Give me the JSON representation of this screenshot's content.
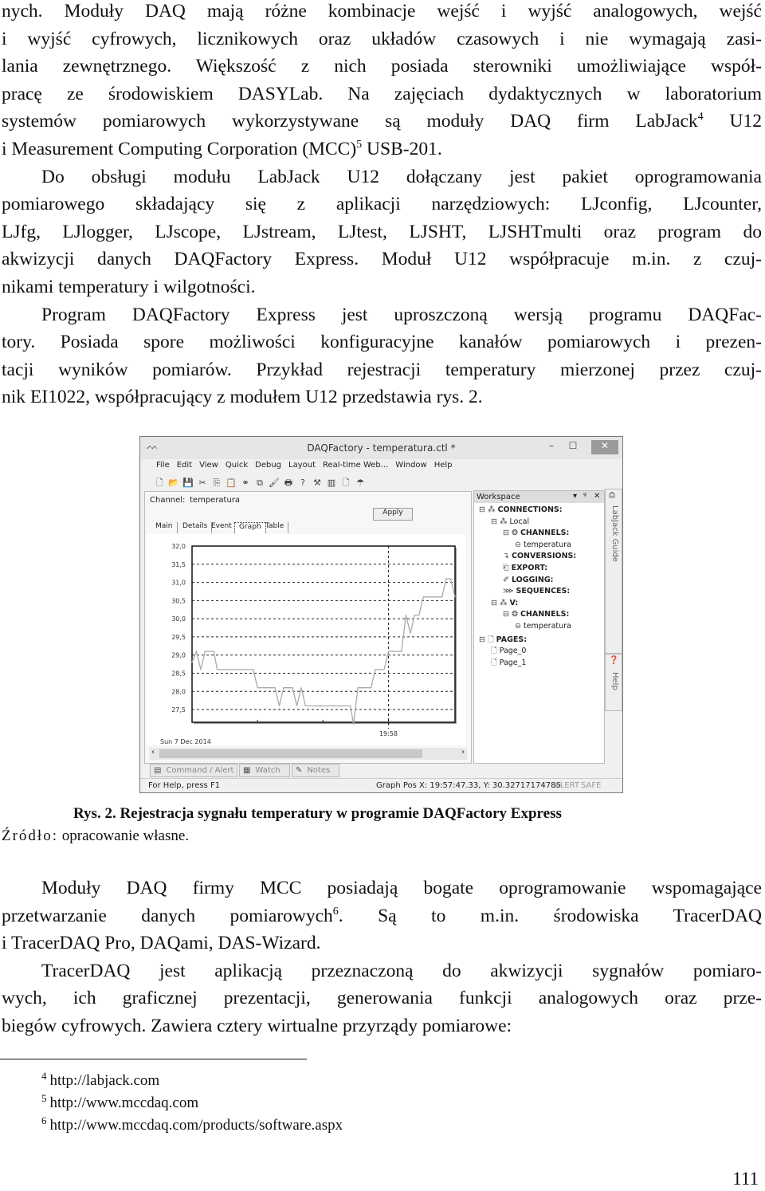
{
  "paragraphs_top": [
    {
      "indent": false,
      "lines": [
        {
          "t": "nych. Moduły DAQ mają różne kombinacje wejść i wyjść analogowych, wejść"
        },
        {
          "t": "i wyjść cyfrowych, licznikowych oraz układów czasowych i nie wymagają zasi-"
        },
        {
          "t": "lania zewnętrznego. Większość z nich posiada sterowniki umożliwiające współ-"
        },
        {
          "t": "pracę ze środowiskiem DASYLab. Na zajęciach dydaktycznych w laboratorium"
        },
        {
          "t": "systemów pomiarowych wykorzystywane są moduły DAQ firm LabJack",
          "sup": "4",
          "t2": " U12"
        },
        {
          "t": "i Measurement Computing Corporation (MCC)",
          "sup": "5",
          "t2": " USB-201."
        }
      ]
    },
    {
      "indent": true,
      "lines": [
        {
          "t": "Do obsługi modułu LabJack U12 dołączany jest pakiet oprogramowania"
        },
        {
          "t": "pomiarowego składający się z aplikacji narzędziowych: LJconfig, LJcounter,"
        },
        {
          "t": "LJfg, LJlogger, LJscope, LJstream, LJtest, LJSHT, LJSHTmulti oraz program do"
        },
        {
          "t": "akwizycji danych DAQFactory Express. Moduł U12 współpracuje m.in. z czuj-"
        },
        {
          "t": "nikami temperatury i wilgotności."
        }
      ]
    },
    {
      "indent": true,
      "lines": [
        {
          "t": "Program DAQFactory Express jest uproszczoną wersją programu DAQFac-"
        },
        {
          "t": "tory. Posiada spore możliwości konfiguracyjne kanałów pomiarowych i prezen-"
        },
        {
          "t": "tacji wyników pomiarów. Przykład rejestracji temperatury mierzonej przez czuj-"
        },
        {
          "t": "nik EI1022, współpracujący z modułem U12 przedstawia rys. 2."
        }
      ]
    }
  ],
  "paragraphs_bottom": [
    {
      "indent": true,
      "lines": [
        {
          "t": "Moduły DAQ firmy MCC posiadają bogate oprogramowanie wspomagające"
        },
        {
          "t": "przetwarzanie danych pomiarowych",
          "sup": "6",
          "t2": ". Są to m.in. środowiska TracerDAQ"
        },
        {
          "t": "i TracerDAQ Pro, DAQami, DAS-Wizard."
        }
      ]
    },
    {
      "indent": true,
      "lines": [
        {
          "t": "TracerDAQ jest aplikacją przeznaczoną do akwizycji sygnałów pomiaro-"
        },
        {
          "t": "wych, ich graficznej prezentacji, generowania funkcji analogowych oraz prze-"
        },
        {
          "t": "biegów cyfrowych. Zawiera cztery wirtualne przyrządy pomiarowe:"
        }
      ]
    }
  ],
  "figure": {
    "caption": "Rys. 2. Rejestracja sygnału temperatury w programie DAQFactory Express",
    "source_label": "Źródło:",
    "source_text": " opracowanie własne."
  },
  "app": {
    "title": "DAQFactory - temperatura.ctl *",
    "window_buttons": {
      "minimize": "–",
      "maximize": "☐",
      "close": "✕"
    },
    "menu": [
      "File",
      "Edit",
      "View",
      "Quick",
      "Debug",
      "Layout",
      "Real-time Web...",
      "Window",
      "Help"
    ],
    "toolbar_icons": [
      "new-icon",
      "open-icon",
      "save-icon",
      "cut-icon",
      "copy-icon",
      "paste-icon",
      "link-icon",
      "duplicate-icon",
      "brush-icon",
      "print-icon",
      "help-icon",
      "tools-icon",
      "chart-icon",
      "page-icon",
      "daq-icon"
    ],
    "toolbar_glyphs": [
      "🗋",
      "📂",
      "💾",
      "✂",
      "⎘",
      "📋",
      "⚭",
      "⧉",
      "🖌",
      "🖶",
      "?",
      "⚒",
      "▥",
      "🗋",
      "☂"
    ],
    "channel_label": "Channel:",
    "channel_value": "temperatura",
    "apply_label": "Apply",
    "tabs": [
      "Main",
      "Details",
      "Event",
      "Graph",
      "Table"
    ],
    "active_tab": "Graph",
    "graph_date": "Sun 7 Dec 2014",
    "bottom_tabs": [
      "Command / Alert",
      "Watch",
      "Notes"
    ],
    "status_help": "For Help, press F1",
    "status_pos": "Graph Pos X: 19:57:47.33, Y: 30.32717174785",
    "status_alert": "ALERT",
    "status_safe": "SAFE",
    "workspace_title": "Workspace",
    "workspace_controls": [
      "▾",
      "ᵠ",
      "✕"
    ],
    "tree": [
      {
        "label": "CONNECTIONS:",
        "level": 0,
        "bold": true,
        "icon": "connection-icon"
      },
      {
        "label": "Local",
        "level": 1,
        "bold": false,
        "icon": "connection-icon"
      },
      {
        "label": "CHANNELS:",
        "level": 2,
        "bold": true,
        "icon": "channels-icon"
      },
      {
        "label": "temperatura",
        "level": 3,
        "bold": false,
        "icon": "channel-icon"
      },
      {
        "label": "CONVERSIONS:",
        "level": 2,
        "bold": true,
        "icon": "conversions-icon"
      },
      {
        "label": "EXPORT:",
        "level": 2,
        "bold": true,
        "icon": "export-icon"
      },
      {
        "label": "LOGGING:",
        "level": 2,
        "bold": true,
        "icon": "logging-icon"
      },
      {
        "label": "SEQUENCES:",
        "level": 2,
        "bold": true,
        "icon": "sequences-icon"
      },
      {
        "label": "V:",
        "level": 1,
        "bold": true,
        "icon": "connection-icon"
      },
      {
        "label": "CHANNELS:",
        "level": 2,
        "bold": true,
        "icon": "channels-icon"
      },
      {
        "label": "temperatura",
        "level": 3,
        "bold": false,
        "icon": "channel-icon"
      },
      {
        "label": "PAGES:",
        "level": 0,
        "bold": true,
        "icon": "page-icon"
      },
      {
        "label": "Page_0",
        "level": 1,
        "bold": false,
        "icon": "page-icon"
      },
      {
        "label": "Page_1",
        "level": 1,
        "bold": false,
        "icon": "page-icon"
      }
    ],
    "side_tabs": [
      "LabJack Guide",
      "Help"
    ]
  },
  "chart_data": {
    "type": "line",
    "x_label": "19:58",
    "date": "Sun 7 Dec 2014",
    "ylim": [
      27.15,
      32.0
    ],
    "xlim": [
      "19:55:00",
      "19:59:01"
    ],
    "y_ticks": [
      "32,0",
      "31,5",
      "31,0",
      "30,5",
      "30,0",
      "29,5",
      "29,0",
      "28,5",
      "28,0",
      "27,5"
    ],
    "y_tick_values": [
      32.0,
      31.5,
      31.0,
      30.5,
      30.0,
      29.5,
      29.0,
      28.5,
      28.0,
      27.5
    ],
    "x_ticks": [
      "19:56:00",
      "19:57:00",
      "19:58:00"
    ],
    "grid": true,
    "series": [
      {
        "x": [
          "19:55:00",
          "19:55:04",
          "19:55:08",
          "19:55:12",
          "19:55:20",
          "19:55:23",
          "19:55:56",
          "19:56:00",
          "19:56:16",
          "19:56:20",
          "19:56:24",
          "19:56:32",
          "19:56:36",
          "19:56:40",
          "19:56:44",
          "19:57:25",
          "19:57:28",
          "19:57:32",
          "19:57:44",
          "19:57:48",
          "19:57:56",
          "19:58:00",
          "19:58:12",
          "19:58:16",
          "19:58:20",
          "19:58:24",
          "19:58:28",
          "19:58:32",
          "19:58:49",
          "19:58:53",
          "19:58:57",
          "19:59:01"
        ],
        "y": [
          28.8,
          29.1,
          28.6,
          29.1,
          29.1,
          28.6,
          28.6,
          28.1,
          28.1,
          27.6,
          28.1,
          28.1,
          27.6,
          28.1,
          27.6,
          27.6,
          27.1,
          28.1,
          28.1,
          28.6,
          28.6,
          29.1,
          29.1,
          30.1,
          29.6,
          30.1,
          30.1,
          30.6,
          30.6,
          31.1,
          31.1,
          30.6
        ]
      }
    ]
  },
  "footnotes": [
    {
      "num": "4",
      "text": "http://labjack.com"
    },
    {
      "num": "5",
      "text": "http://www.mccdaq.com"
    },
    {
      "num": "6",
      "text": "http://www.mccdaq.com/products/software.aspx"
    }
  ],
  "page_number": "111"
}
